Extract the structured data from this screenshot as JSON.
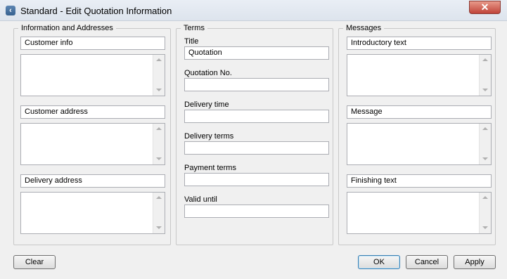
{
  "window": {
    "title": "Standard - Edit Quotation Information",
    "close_glyph": "✕"
  },
  "groups": {
    "info": {
      "legend": "Information and Addresses",
      "customer_info_label": "Customer info",
      "customer_address_label": "Customer address",
      "delivery_address_label": "Delivery address"
    },
    "terms": {
      "legend": "Terms",
      "title_label": "Title",
      "title_value": "Quotation",
      "quotation_no_label": "Quotation No.",
      "quotation_no_value": "",
      "delivery_time_label": "Delivery time",
      "delivery_time_value": "",
      "delivery_terms_label": "Delivery terms",
      "delivery_terms_value": "",
      "payment_terms_label": "Payment terms",
      "payment_terms_value": "",
      "valid_until_label": "Valid until",
      "valid_until_value": ""
    },
    "messages": {
      "legend": "Messages",
      "introductory_label": "Introductory text",
      "message_label": "Message",
      "finishing_label": "Finishing text"
    }
  },
  "buttons": {
    "clear": "Clear",
    "ok": "OK",
    "cancel": "Cancel",
    "apply": "Apply"
  },
  "colors": {
    "default_button_border": "#3c7fb1",
    "close_button": "#c0443a"
  }
}
